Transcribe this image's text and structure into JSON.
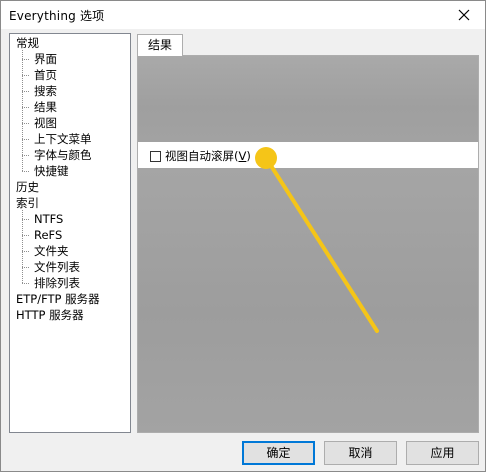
{
  "window": {
    "title": "Everything 选项",
    "close_label": "✕"
  },
  "tree": {
    "items": [
      {
        "label": "常规",
        "level": 0
      },
      {
        "label": "界面",
        "level": 1
      },
      {
        "label": "首页",
        "level": 1
      },
      {
        "label": "搜索",
        "level": 1
      },
      {
        "label": "结果",
        "level": 1
      },
      {
        "label": "视图",
        "level": 1
      },
      {
        "label": "上下文菜单",
        "level": 1
      },
      {
        "label": "字体与颜色",
        "level": 1
      },
      {
        "label": "快捷键",
        "level": 1
      },
      {
        "label": "历史",
        "level": 0
      },
      {
        "label": "索引",
        "level": 0
      },
      {
        "label": "NTFS",
        "level": 1
      },
      {
        "label": "ReFS",
        "level": 1
      },
      {
        "label": "文件夹",
        "level": 1
      },
      {
        "label": "文件列表",
        "level": 1
      },
      {
        "label": "排除列表",
        "level": 1
      },
      {
        "label": "ETP/FTP 服务器",
        "level": 0
      },
      {
        "label": "HTTP 服务器",
        "level": 0
      }
    ]
  },
  "tab": {
    "label": "结果"
  },
  "options": {
    "auto_scroll_label": "视图自动滚屏",
    "auto_scroll_shortcut": "V",
    "auto_scroll_checked": false
  },
  "buttons": {
    "ok": "确定",
    "cancel": "取消",
    "apply": "应用"
  },
  "colors": {
    "accent": "#0078d7",
    "highlight_pointer": "#f5c518"
  }
}
